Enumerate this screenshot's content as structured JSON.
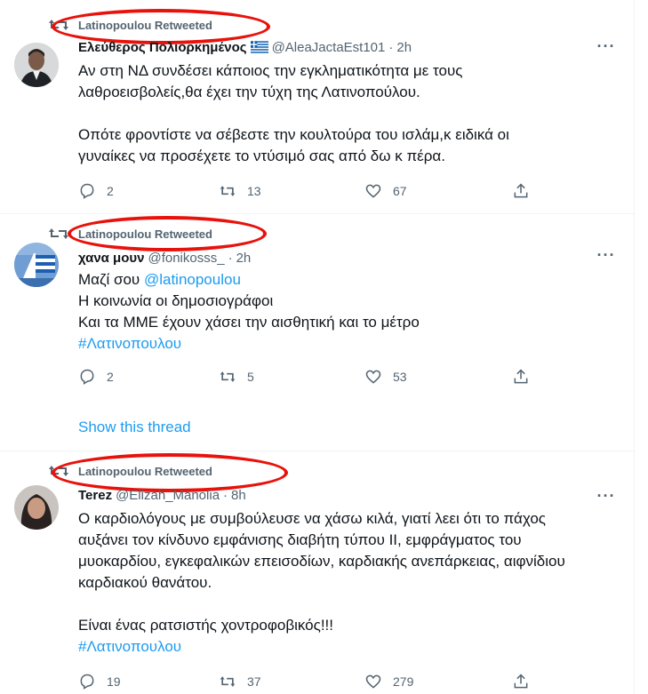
{
  "tweets": [
    {
      "retweet_label": "Latinopoulou Retweeted",
      "name": "Ελεύθερος Πολιορκημένος",
      "handle": "@AleaJactaEst101",
      "dot": "·",
      "time": "2h",
      "more": "···",
      "lines": [
        "Αν στη ΝΔ συνδέσει κάποιος την εγκληματικότητα με τους",
        "λαθροεισβολείς,θα έχει την τύχη της Λατινοπούλου.",
        "",
        "Οπότε φροντίστε να σέβεστε την κουλτούρα του ισλάμ,κ ειδικά οι",
        "γυναίκες να προσέχετε το ντύσιμό σας από δω κ πέρα."
      ],
      "replies": "2",
      "retweets": "13",
      "likes": "67"
    },
    {
      "retweet_label": "Latinopoulou Retweeted",
      "name": "χανα μουν",
      "handle": "@fonikosss_",
      "dot": "·",
      "time": "2h",
      "more": "···",
      "line1_prefix": "Μαζί σου ",
      "line1_mention": "@latinopoulou",
      "line2": "Η κοινωνία οι δημοσιογράφοι",
      "line3": "Και τα ΜΜΕ έχουν χάσει την αισθητική και το μέτρο",
      "hashtag": "#Λατινοπουλου",
      "replies": "2",
      "retweets": "5",
      "likes": "53",
      "show_thread": "Show this thread"
    },
    {
      "retweet_label": "Latinopoulou Retweeted",
      "name": "Terez",
      "handle": "@Elizah_Manolia",
      "dot": "·",
      "time": "8h",
      "more": "···",
      "lines": [
        "Ο καρδιολόγους με συμβούλευσε να χάσω κιλά, γιατί λεει ότι το πάχος",
        "αυξάνει τον κίνδυνο εμφάνισης διαβήτη τύπου ΙΙ, εμφράγματος του",
        "μυοκαρδίου, εγκεφαλικών  επεισοδίων, καρδιακής ανεπάρκειας, αιφνίδιου",
        "καρδιακού  θανάτου.",
        "",
        "Είναι ένας ρατσιστής χοντροφοβικός!!!"
      ],
      "hashtag": "#Λατινοπουλου",
      "replies": "19",
      "retweets": "37",
      "likes": "279"
    }
  ],
  "colors": {
    "accent": "#1d9bf0",
    "secondary": "#536471",
    "annotation": "#e8120c"
  },
  "icons": [
    "retweet-icon",
    "reply-icon",
    "like-icon",
    "share-icon",
    "more-icon",
    "greek-flag-icon"
  ]
}
